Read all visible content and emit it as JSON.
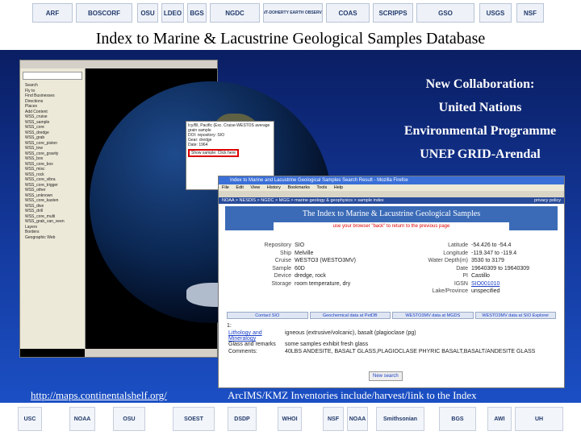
{
  "header_logos": [
    "ARF",
    "BOSCORF",
    "OSU",
    "LDEO",
    "BGS",
    "NGDC",
    "LAMONT-DOHERTY EARTH OBSERVATORY",
    "COAS",
    "SCRIPPS",
    "GSO",
    "USGS",
    "NSF"
  ],
  "title": "Index to Marine & Lacustrine Geological Samples Database",
  "collaboration": {
    "line1": "New Collaboration:",
    "line2": "United Nations",
    "line3": "Environmental Programme",
    "line4": "UNEP GRID-Arendal"
  },
  "google_earth": {
    "sidebar_rows": [
      "Search",
      "Fly to",
      "Find Businesses",
      "Directions",
      "Places",
      "Add Content",
      "WSS_cruise",
      "WSS_sample",
      "WSS_core",
      "WSS_dredge",
      "WSS_grab",
      "WSS_core_piston",
      "WSS_tow",
      "WSS_core_gravity",
      "WSS_box",
      "WSS_core_box",
      "WSS_misc",
      "WSS_rock",
      "WSS_core_vibra",
      "WSS_core_trigger",
      "WSS_other",
      "WSS_unknown",
      "WSS_core_kasten",
      "WSS_dive",
      "WSS_drill",
      "WSS_core_multi",
      "WSS_grab_van_veen",
      "Layers",
      "Borders",
      "Geographic Web"
    ],
    "popup_lines": [
      "Icy/BI, Pacific (Exc. Cruise-WESTOS average grain sample",
      "DOI: repository: SIO",
      "Gear: dredge",
      "Date: 1964"
    ],
    "popup_highlight": "Show sample: Click here"
  },
  "browser": {
    "title_bar": "Index to Marine and Lacustrine Geological Samples Search Result - Mozilla Firefox",
    "menu": [
      "File",
      "Edit",
      "View",
      "History",
      "Bookmarks",
      "Tools",
      "Help"
    ],
    "breadcrumb": "NOAA > NESDIS > NGDC > MGG > marine geology & geophysics > sample index",
    "privacy": "privacy policy",
    "banner_title": "The Index to Marine & Lacustrine Geological Samples",
    "banner_sub": "use your browser \"back\" to return to the previous page",
    "fields": [
      {
        "label": "Repository",
        "value": "SIO",
        "label2": "Latitude",
        "value2": "-54.426 to -54.4"
      },
      {
        "label": "Ship",
        "value": "Melville",
        "label2": "Longitude",
        "value2": "-119.347 to -119.4"
      },
      {
        "label": "Cruise",
        "value": "WESTO3 (WESTO3MV)",
        "label2": "Water Depth(m)",
        "value2": "3530 to 3179"
      },
      {
        "label": "Sample",
        "value": "60D",
        "label2": "Date",
        "value2": "19640309 to 19640309"
      },
      {
        "label": "Device",
        "value": "dredge, rock",
        "label2": "PI",
        "value2": "Castillo"
      },
      {
        "label": "Storage",
        "value": "room temperature, dry",
        "label2": "IGSN",
        "value2": "SIO001010"
      },
      {
        "label": "",
        "value": "",
        "label2": "Lake/Province",
        "value2": "unspecified"
      }
    ],
    "tabs": [
      "Contact SIO",
      "Geochemical data at PetDB",
      "WESTO3MV data at MGDS",
      "WESTO3MV data at SIO Explorer"
    ],
    "section_header": "1:",
    "description": [
      {
        "label": "Lithology and Mineralogy",
        "value": "igneous (extrusive/volcanic), basalt (plagioclase (pg)"
      },
      {
        "label": "Glass and remarks",
        "value": "some samples exhibit fresh glass"
      },
      {
        "label": "Comments:",
        "value": "40LBS ANDESITE, BASALT GLASS,PLAGIOCLASE PHYRIC BASALT,BASALT/ANDESITE GLASS"
      }
    ],
    "new_search": "New search"
  },
  "bottom_link": "http://maps.continentalshelf.org/",
  "bottom_text": "ArcIMS/KMZ Inventories include/harvest/link to the Index",
  "footer_logos": [
    "USC",
    "NOAA",
    "OSU",
    "SOEST",
    "DSDP",
    "WHOI",
    "NSF",
    "NOAA",
    "Smithsonian",
    "BGS",
    "AWI",
    "UH"
  ]
}
